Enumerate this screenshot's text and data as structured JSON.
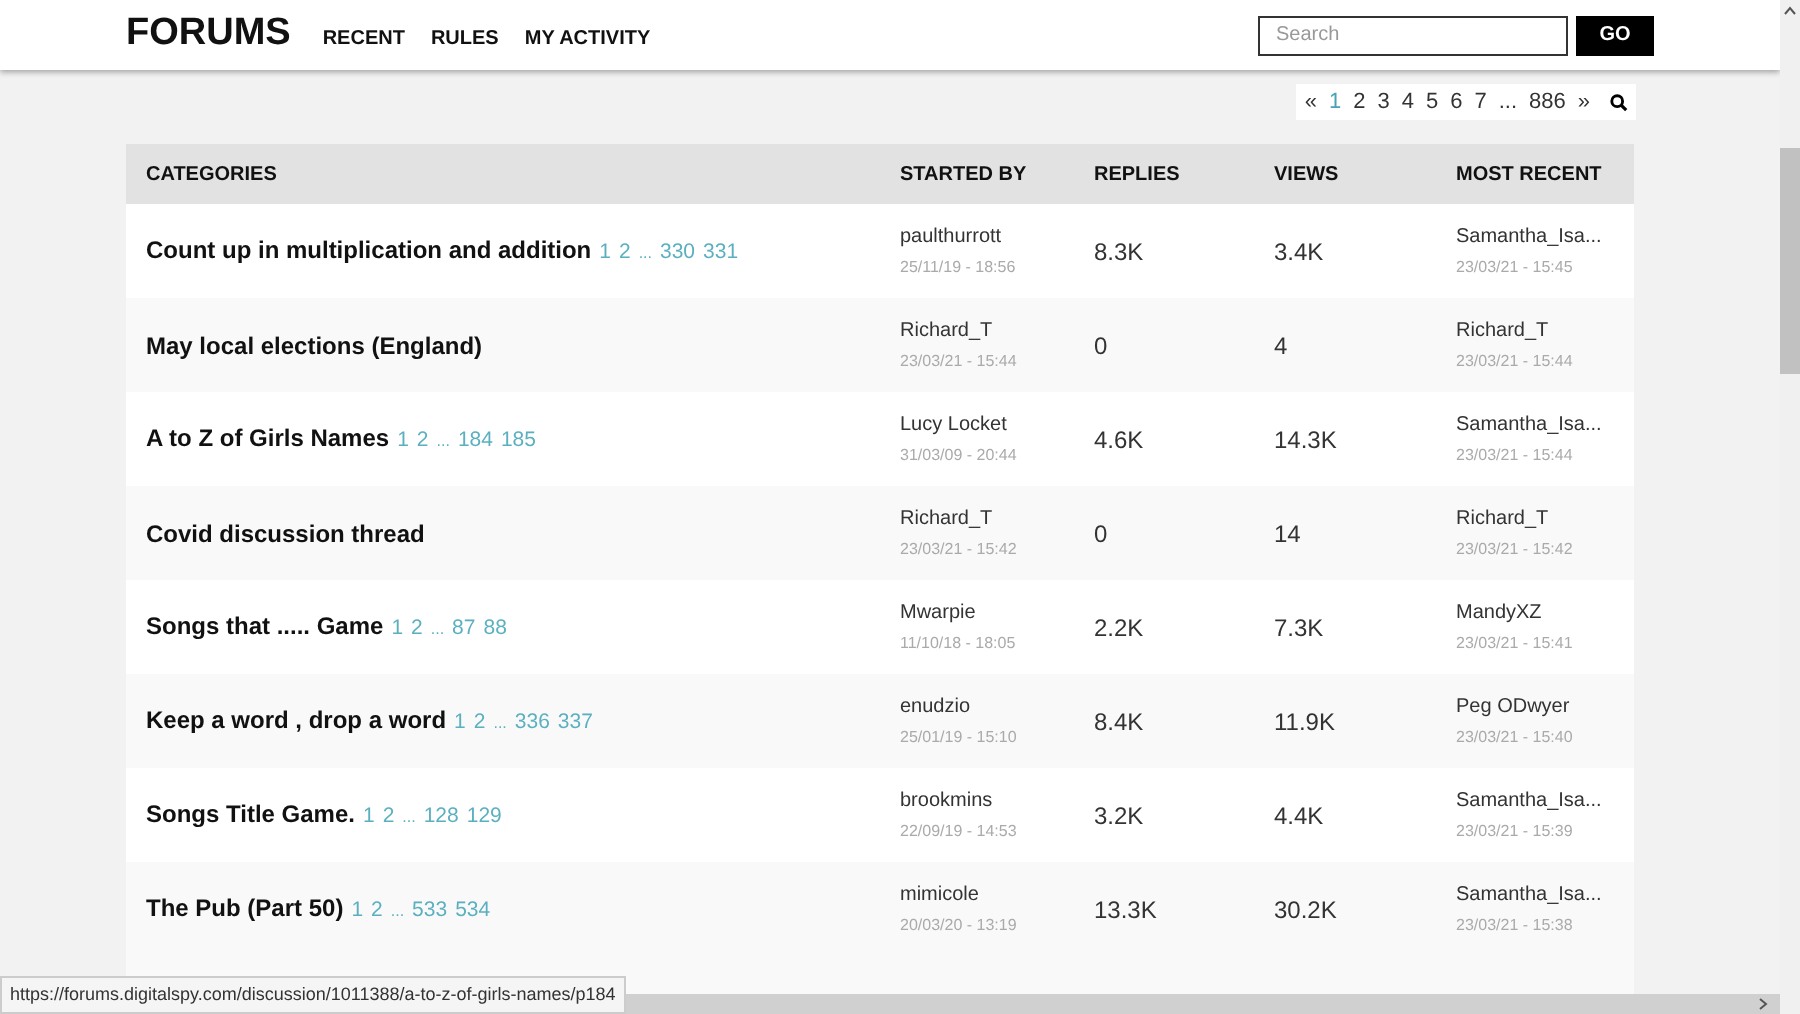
{
  "header": {
    "logo": "FORUMS",
    "nav": [
      "RECENT",
      "RULES",
      "MY ACTIVITY"
    ],
    "search": {
      "placeholder": "Search"
    },
    "go_button": "GO"
  },
  "pagination": {
    "prev": "«",
    "next": "»",
    "pages": [
      {
        "label": "1",
        "selected": true
      },
      {
        "label": "2",
        "selected": false
      },
      {
        "label": "3",
        "selected": false
      },
      {
        "label": "4",
        "selected": false
      },
      {
        "label": "5",
        "selected": false
      },
      {
        "label": "6",
        "selected": false
      },
      {
        "label": "7",
        "selected": false
      },
      {
        "label": "...",
        "selected": false
      },
      {
        "label": "886",
        "selected": false
      }
    ]
  },
  "table": {
    "columns": [
      "CATEGORIES",
      "STARTED BY",
      "REPLIES",
      "VIEWS",
      "MOST RECENT"
    ],
    "rows": [
      {
        "title": "Count up in multiplication and addition",
        "pages": [
          "1",
          "2",
          "...",
          "330",
          "331"
        ],
        "started_by": "paulthurrott",
        "started_at": "25/11/19 - 18:56",
        "replies": "8.3K",
        "views": "3.4K",
        "recent_by": "Samantha_Isa...",
        "recent_at": "23/03/21 - 15:45"
      },
      {
        "title": "May local elections (England)",
        "pages": [],
        "started_by": "Richard_T",
        "started_at": "23/03/21 - 15:44",
        "replies": "0",
        "views": "4",
        "recent_by": "Richard_T",
        "recent_at": "23/03/21 - 15:44"
      },
      {
        "title": "A to Z of Girls Names",
        "pages": [
          "1",
          "2",
          "...",
          "184",
          "185"
        ],
        "started_by": "Lucy Locket",
        "started_at": "31/03/09 - 20:44",
        "replies": "4.6K",
        "views": "14.3K",
        "recent_by": "Samantha_Isa...",
        "recent_at": "23/03/21 - 15:44"
      },
      {
        "title": "Covid discussion thread",
        "pages": [],
        "started_by": "Richard_T",
        "started_at": "23/03/21 - 15:42",
        "replies": "0",
        "views": "14",
        "recent_by": "Richard_T",
        "recent_at": "23/03/21 - 15:42"
      },
      {
        "title": "Songs that ..... Game",
        "pages": [
          "1",
          "2",
          "...",
          "87",
          "88"
        ],
        "started_by": "Mwarpie",
        "started_at": "11/10/18 - 18:05",
        "replies": "2.2K",
        "views": "7.3K",
        "recent_by": "MandyXZ",
        "recent_at": "23/03/21 - 15:41"
      },
      {
        "title": "Keep a word , drop a word",
        "pages": [
          "1",
          "2",
          "...",
          "336",
          "337"
        ],
        "started_by": "enudzio",
        "started_at": "25/01/19 - 15:10",
        "replies": "8.4K",
        "views": "11.9K",
        "recent_by": "Peg ODwyer",
        "recent_at": "23/03/21 - 15:40"
      },
      {
        "title": "Songs Title Game.",
        "pages": [
          "1",
          "2",
          "...",
          "128",
          "129"
        ],
        "started_by": "brookmins",
        "started_at": "22/09/19 - 14:53",
        "replies": "3.2K",
        "views": "4.4K",
        "recent_by": "Samantha_Isa...",
        "recent_at": "23/03/21 - 15:39"
      },
      {
        "title": "The Pub (Part 50)",
        "pages": [
          "1",
          "2",
          "...",
          "533",
          "534"
        ],
        "started_by": "mimicole",
        "started_at": "20/03/20 - 13:19",
        "replies": "13.3K",
        "views": "30.2K",
        "recent_by": "Samantha_Isa...",
        "recent_at": "23/03/21 - 15:38"
      }
    ]
  },
  "status_url": "https://forums.digitalspy.com/discussion/1011388/a-to-z-of-girls-names/p184"
}
